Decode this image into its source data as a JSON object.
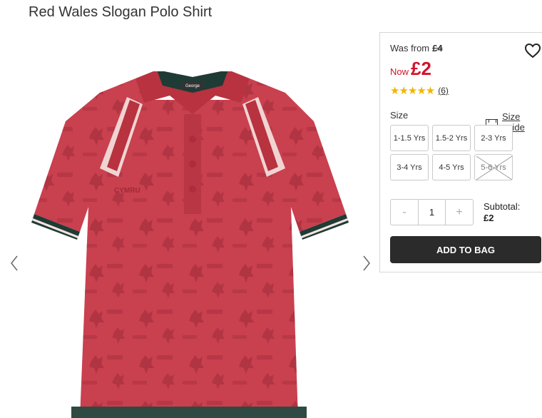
{
  "product": {
    "title": "Red Wales Slogan Polo Shirt",
    "image_label": "George",
    "print_text": "CYMRU"
  },
  "gallery": {
    "prev_icon": "chevron-left-icon",
    "next_icon": "chevron-right-icon"
  },
  "pricing": {
    "was_label": "Was from",
    "was_price": "£4",
    "now_label": "Now",
    "now_price": "£2"
  },
  "wishlist": {
    "icon": "heart-icon"
  },
  "rating": {
    "stars": "★★★★★",
    "value": 4.5,
    "max": 5,
    "review_count": "(6)"
  },
  "sizes": {
    "label": "Size",
    "guide_label": "Size guide",
    "guide_icon": "ruler-icon",
    "options": [
      {
        "label": "1-1.5 Yrs",
        "available": true
      },
      {
        "label": "1.5-2 Yrs",
        "available": true
      },
      {
        "label": "2-3 Yrs",
        "available": true
      },
      {
        "label": "3-4 Yrs",
        "available": true
      },
      {
        "label": "4-5 Yrs",
        "available": true
      },
      {
        "label": "5-6 Yrs",
        "available": false
      }
    ]
  },
  "quantity": {
    "minus": "-",
    "value": "1",
    "plus": "+"
  },
  "subtotal": {
    "label": "Subtotal:",
    "amount": "£2"
  },
  "cta": {
    "add_to_bag": "ADD TO BAG"
  },
  "colors": {
    "price_red": "#d0152b",
    "star_gold": "#f1b600",
    "button_dark": "#2b2b2b",
    "shirt_red": "#c9404f"
  }
}
